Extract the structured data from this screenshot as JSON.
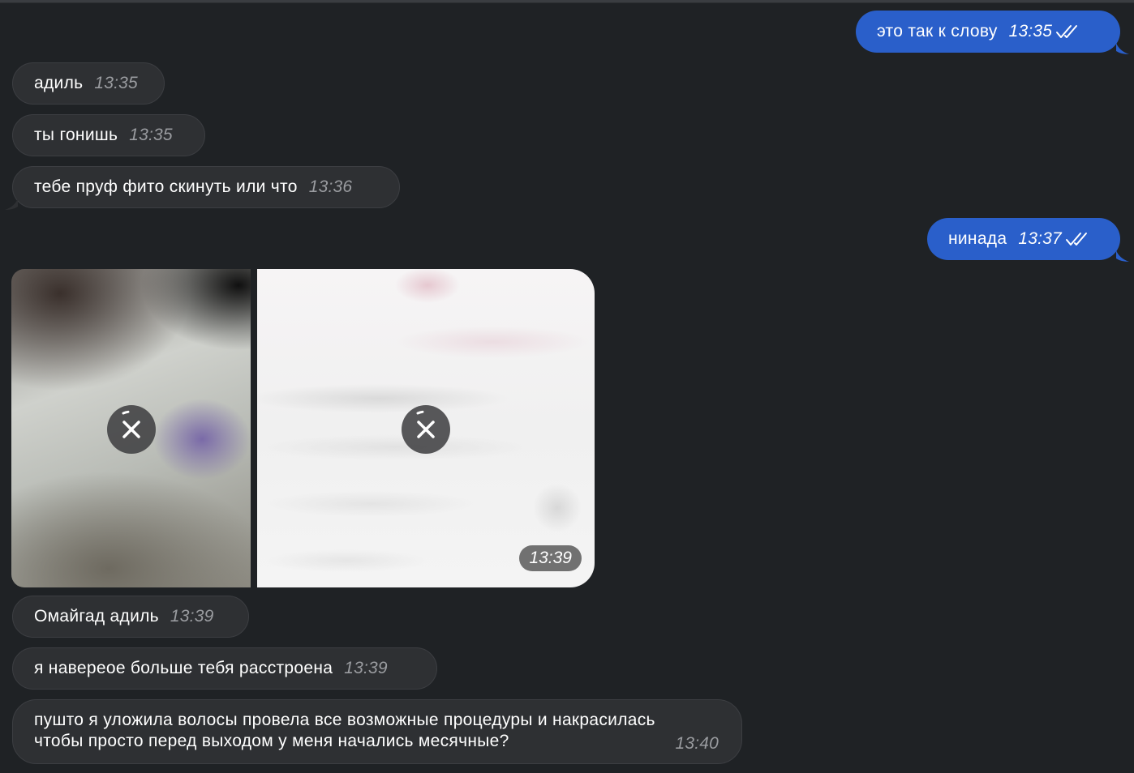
{
  "messages": [
    {
      "dir": "out",
      "text": "это так к слову",
      "time": "13:35",
      "read": true
    },
    {
      "dir": "in",
      "text": "адиль",
      "time": "13:35"
    },
    {
      "dir": "in",
      "text": "ты гонишь",
      "time": "13:35"
    },
    {
      "dir": "in",
      "text": "тебе пруф фито скинуть или что",
      "time": "13:36"
    },
    {
      "dir": "out",
      "text": "нинада",
      "time": "13:37",
      "read": true
    },
    {
      "dir": "in",
      "type": "photos",
      "time": "13:39",
      "count": 2,
      "status": "uploading"
    },
    {
      "dir": "in",
      "text": "Омайгад адиль",
      "time": "13:39"
    },
    {
      "dir": "in",
      "text": "я навереое больше тебя расстроена",
      "time": "13:39"
    },
    {
      "dir": "in",
      "text": "пушто я уложила волосы провела все возможные процедуры и накрасилась\nчтобы просто перед выходом у меня начались месячные?",
      "time": "13:40"
    }
  ],
  "icons": {
    "read_receipt": "double-check-icon",
    "cancel_upload": "close-icon"
  },
  "colors": {
    "background": "#1f2225",
    "incoming_bubble": "#2e3033",
    "outgoing_bubble": "#2a5fca"
  }
}
